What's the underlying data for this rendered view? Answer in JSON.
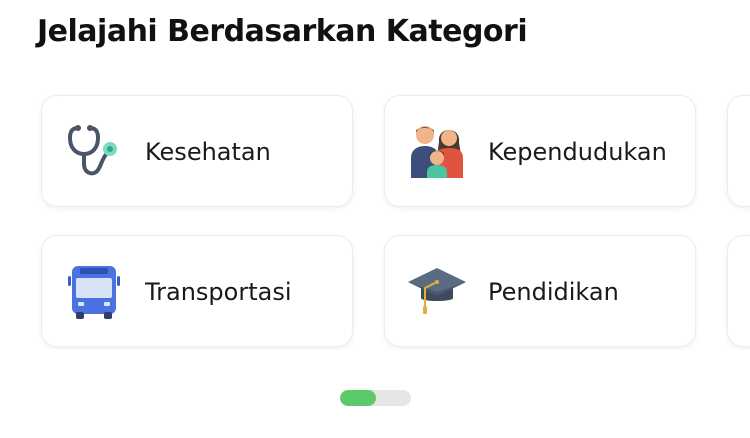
{
  "section": {
    "title": "Jelajahi Berdasarkan Kategori"
  },
  "categories": [
    {
      "label": "Kesehatan",
      "icon": "stethoscope-icon"
    },
    {
      "label": "Kependudukan",
      "icon": "family-icon"
    },
    {
      "label": "Transportasi",
      "icon": "bus-icon"
    },
    {
      "label": "Pendidikan",
      "icon": "graduation-cap-icon"
    }
  ],
  "pager": {
    "progress": 0.5,
    "active_color": "#5cc96a",
    "track_color": "#e6e6e6"
  }
}
